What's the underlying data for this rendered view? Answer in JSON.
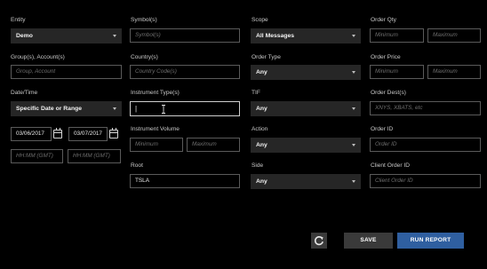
{
  "entity": {
    "label": "Entity",
    "value": "Demo"
  },
  "groups_accounts": {
    "label": "Group(s), Account(s)",
    "placeholder": "Group, Account"
  },
  "datetime": {
    "label": "Date/Time",
    "value": "Specific Date or Range",
    "start_date": "03/06/2017",
    "end_date": "03/07/2017",
    "start_time_placeholder": "HH:MM (GMT)",
    "end_time_placeholder": "HH:MM (GMT)"
  },
  "symbols": {
    "label": "Symbol(s)",
    "placeholder": "Symbol(s)"
  },
  "countries": {
    "label": "Country(s)",
    "placeholder": "Country Code(s)"
  },
  "instrument_types": {
    "label": "Instrument Type(s)",
    "value": "|"
  },
  "instrument_volume": {
    "label": "Instrument Volume",
    "min_placeholder": "Minimum",
    "max_placeholder": "Maximum"
  },
  "root": {
    "label": "Root",
    "value": "TSLA"
  },
  "scope": {
    "label": "Scope",
    "value": "All Messages"
  },
  "order_type": {
    "label": "Order Type",
    "value": "Any"
  },
  "tif": {
    "label": "TIF",
    "value": "Any"
  },
  "action": {
    "label": "Action",
    "value": "Any"
  },
  "side": {
    "label": "Side",
    "value": "Any"
  },
  "order_qty": {
    "label": "Order Qty",
    "min_placeholder": "Minimum",
    "max_placeholder": "Maximum"
  },
  "order_price": {
    "label": "Order Price",
    "min_placeholder": "Minimum",
    "max_placeholder": "Maximum"
  },
  "order_dest": {
    "label": "Order Dest(s)",
    "placeholder": "XNYS, XBATS, etc"
  },
  "order_id": {
    "label": "Order ID",
    "placeholder": "Order ID"
  },
  "client_order_id": {
    "label": "Client Order ID",
    "placeholder": "Client Order ID"
  },
  "actions": {
    "save_label": "SAVE",
    "run_label": "RUN REPORT"
  },
  "colors": {
    "accent": "#2f5fa0",
    "select_bg": "#262626",
    "save_bg": "#3a3a3a",
    "background": "#000000"
  },
  "icons": {
    "reset": "refresh-icon",
    "calendar": "calendar-icon",
    "dropdown": "chevron-down-icon",
    "cursor": "text-cursor-icon"
  }
}
